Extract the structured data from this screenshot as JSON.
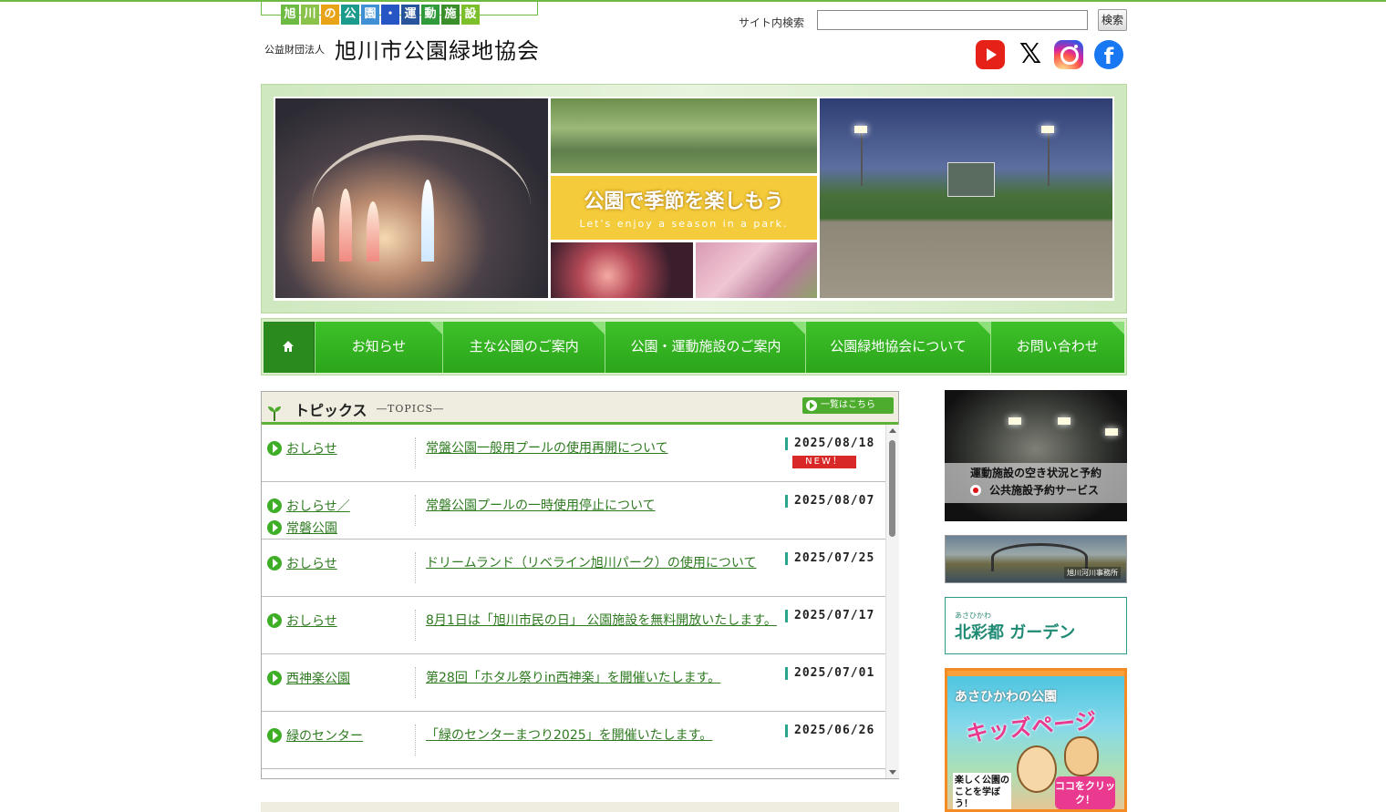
{
  "header": {
    "tagline_chars": [
      "旭",
      "川",
      "の",
      "公",
      "園",
      "・",
      "運",
      "動",
      "施",
      "設"
    ],
    "tagline_colors": [
      "#6dbb43",
      "#8bc34a",
      "#e8a317",
      "#1a9b8c",
      "#3f8fd4",
      "#2655c4",
      "#27549b",
      "#2f9b3b",
      "#3b8f2a",
      "#7bbf2a"
    ],
    "org_prefix": "公益財団法人",
    "org_name": "旭川市公園緑地協会"
  },
  "search": {
    "label": "サイト内検索",
    "value": "",
    "button": "検索"
  },
  "social": {
    "icons": [
      "youtube-icon",
      "x-icon",
      "instagram-icon",
      "facebook-icon"
    ],
    "x_glyph": "𝕏",
    "fb_glyph": "f"
  },
  "hero": {
    "banner_title": "公園で季節を楽しもう",
    "banner_sub": "Let's enjoy a season in a park."
  },
  "nav": {
    "home_icon": "home-icon",
    "items": [
      {
        "label": "お知らせ"
      },
      {
        "label": "主な公園のご案内"
      },
      {
        "label": "公園・運動施設のご案内"
      },
      {
        "label": "公園緑地協会について"
      },
      {
        "label": "お問い合わせ"
      }
    ]
  },
  "topics": {
    "title": "トピックス",
    "subtitle": "―TOPICS―",
    "list_button": "一覧はこちら",
    "new_label": "NEW！",
    "rows": [
      {
        "cats": [
          "おしらせ"
        ],
        "title": "常盤公園一般用プールの使用再開について",
        "date": "2025/08/18"
      },
      {
        "cats": [
          "おしらせ／",
          "常磐公園"
        ],
        "title": "常磐公園プールの一時使用停止について",
        "date": "2025/08/07"
      },
      {
        "cats": [
          "おしらせ"
        ],
        "title": "ドリームランド（リベライン旭川パーク）の使用について",
        "date": "2025/07/25"
      },
      {
        "cats": [
          "おしらせ"
        ],
        "title": "8月1日は「旭川市民の日」 公園施設を無料開放いたします。",
        "date": "2025/07/17"
      },
      {
        "cats": [
          "西神楽公園"
        ],
        "title": "第28回「ホタル祭りin西神楽」を開催いたします。",
        "date": "2025/07/01"
      },
      {
        "cats": [
          "緑のセンター"
        ],
        "title": "「緑のセンターまつり2025」を開催いたします。",
        "date": "2025/06/26"
      }
    ]
  },
  "sidebar": {
    "reserve_line1": "運動施設の空き状況と予約",
    "reserve_line2": "公共施設予約サービス",
    "river_label": "旭川河川事務所",
    "garden_ruby": "あさひかわ",
    "garden_name": "北彩都 ガーデン",
    "kids_line1": "あさひかわの公園",
    "kids_line2": "キッズページ",
    "kids_line3": "楽しく公園のことを学ぼう！",
    "kids_line4": "ココをクリック！"
  }
}
